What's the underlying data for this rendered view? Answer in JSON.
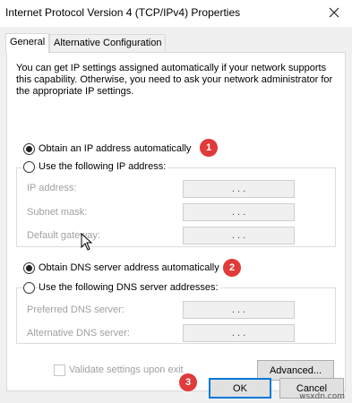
{
  "window": {
    "title": "Internet Protocol Version 4 (TCP/IPv4) Properties",
    "close_icon": "close-icon"
  },
  "tabs": [
    {
      "label": "General",
      "active": true
    },
    {
      "label": "Alternative Configuration",
      "active": false
    }
  ],
  "description": "You can get IP settings assigned automatically if your network supports this capability. Otherwise, you need to ask your network administrator for the appropriate IP settings.",
  "ip": {
    "auto_label": "Obtain an IP address automatically",
    "auto_selected": true,
    "manual_label": "Use the following IP address:",
    "fields": [
      {
        "label": "IP address:",
        "value": ". . ."
      },
      {
        "label": "Subnet mask:",
        "value": ". . ."
      },
      {
        "label": "Default gateway:",
        "value": ". . ."
      }
    ]
  },
  "dns": {
    "auto_label": "Obtain DNS server address automatically",
    "auto_selected": true,
    "manual_label": "Use the following DNS server addresses:",
    "fields": [
      {
        "label": "Preferred DNS server:",
        "value": ". . ."
      },
      {
        "label": "Alternative DNS server:",
        "value": ". . ."
      }
    ]
  },
  "validate_label": "Validate settings upon exit",
  "buttons": {
    "advanced": "Advanced...",
    "ok": "OK",
    "cancel": "Cancel"
  },
  "badges": [
    "1",
    "2",
    "3"
  ],
  "colors": {
    "badge": "#e03a3a",
    "focus": "#0078d7"
  },
  "watermark": "wsxdn.com"
}
